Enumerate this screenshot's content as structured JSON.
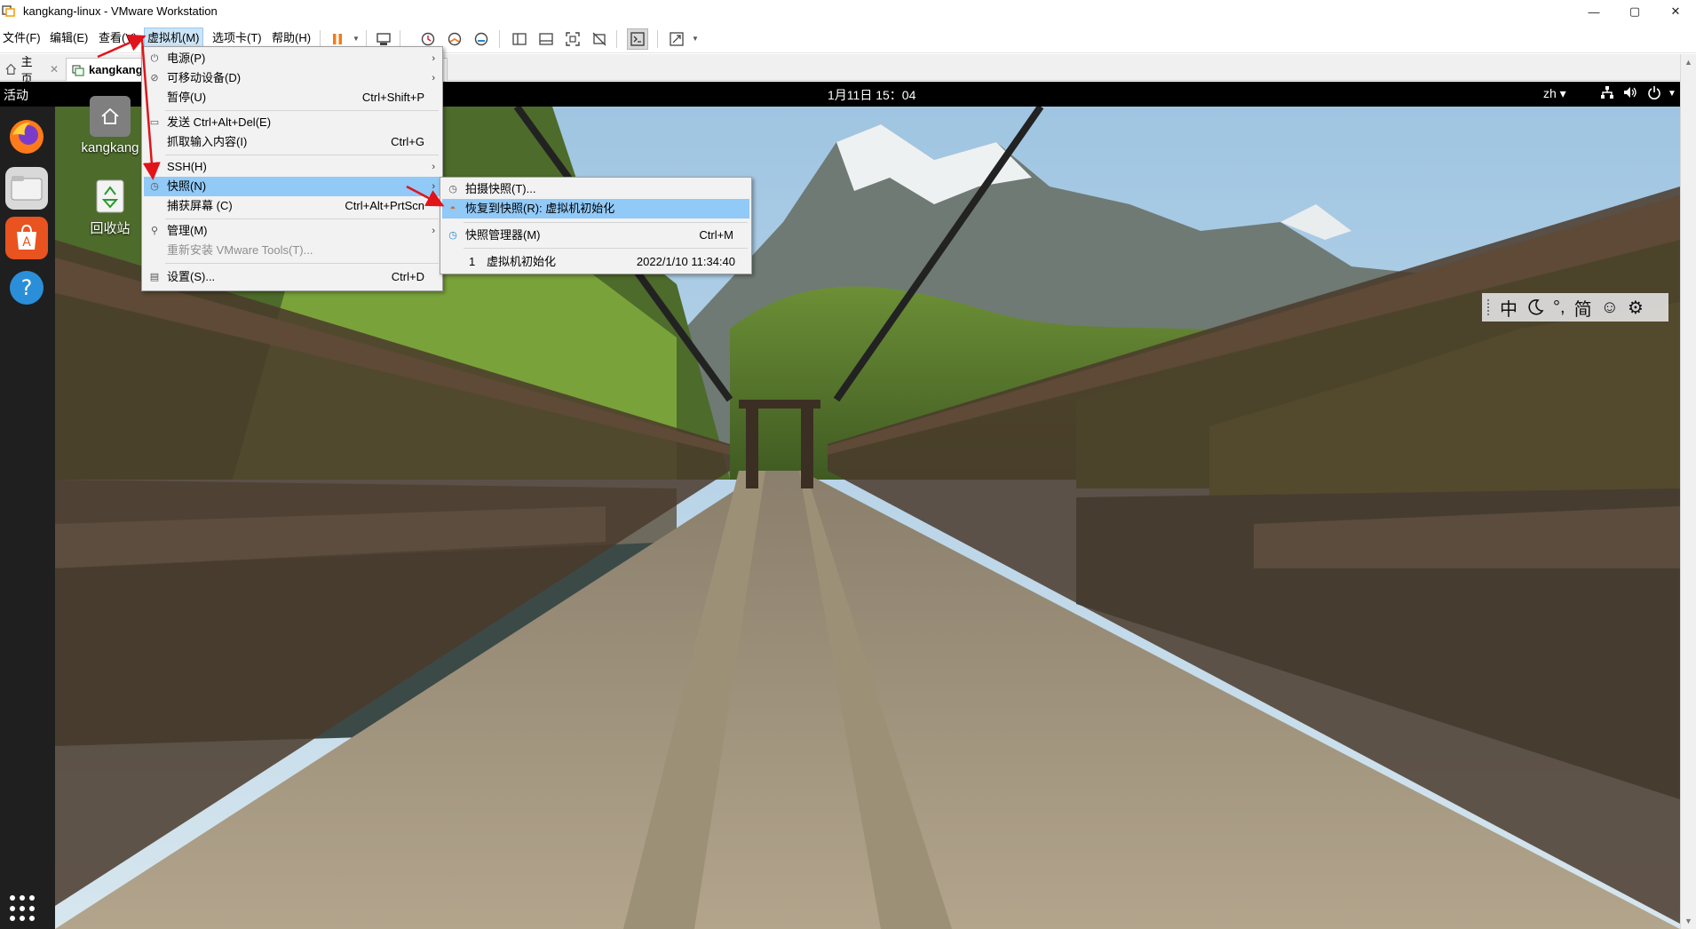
{
  "window": {
    "title": "kangkang-linux - VMware Workstation",
    "minimize": "—",
    "maximize": "▢",
    "close": "✕"
  },
  "menubar": {
    "file": "文件(F)",
    "edit": "编辑(E)",
    "view": "查看(V)",
    "vm": "虚拟机(M)",
    "tabs": "选项卡(T)",
    "help": "帮助(H)"
  },
  "toolbar": {
    "icons": [
      "pause-icon",
      "send-ctrl-alt-del-icon",
      "snapshot-take-icon",
      "snapshot-revert-icon",
      "snapshot-manager-icon",
      "show-library-icon",
      "thumbnail-bar-icon",
      "full-screen-icon",
      "unity-icon",
      "console-view-icon",
      "stretch-guest-icon"
    ]
  },
  "tabs": [
    {
      "label": "主页",
      "close": "✕"
    },
    {
      "label": "kangkang-",
      "close": ""
    }
  ],
  "guest": {
    "activities": "活动",
    "clock": "1月11日  15：04",
    "lang": "zh ▾",
    "desktop_icons": [
      {
        "label": "kangkang"
      },
      {
        "label": "回收站"
      }
    ],
    "ime": {
      "chinese": "中",
      "punct": "°,",
      "simplified": "简",
      "emoji": "☺",
      "settings": "⚙"
    }
  },
  "vm_menu": {
    "items": [
      {
        "label": "电源(P)",
        "shortcut": "",
        "submenu": true
      },
      {
        "label": "可移动设备(D)",
        "shortcut": "",
        "submenu": true
      },
      {
        "label": "暂停(U)",
        "shortcut": "Ctrl+Shift+P",
        "submenu": false
      },
      {
        "label": "发送 Ctrl+Alt+Del(E)",
        "shortcut": "",
        "submenu": false
      },
      {
        "label": "抓取输入内容(I)",
        "shortcut": "Ctrl+G",
        "submenu": false
      },
      {
        "label": "SSH(H)",
        "shortcut": "",
        "submenu": true
      },
      {
        "label": "快照(N)",
        "shortcut": "",
        "submenu": true
      },
      {
        "label": "捕获屏幕 (C)",
        "shortcut": "Ctrl+Alt+PrtScn",
        "submenu": false
      },
      {
        "label": "管理(M)",
        "shortcut": "",
        "submenu": true
      },
      {
        "label": "重新安装 VMware Tools(T)...",
        "shortcut": "",
        "submenu": false
      },
      {
        "label": "设置(S)...",
        "shortcut": "Ctrl+D",
        "submenu": false
      }
    ],
    "submenu_arrow": "›"
  },
  "snapshot_menu": {
    "take": "拍摄快照(T)...",
    "revert": "恢复到快照(R): 虚拟机初始化",
    "manager": "快照管理器(M)",
    "manager_shortcut": "Ctrl+M",
    "recent": {
      "index": "1",
      "name": "虚拟机初始化",
      "time": "2022/1/10 11:34:40"
    }
  },
  "colors": {
    "menu_highlight": "#91c9f7",
    "annotation_arrow": "#e0141a",
    "gnome_bar": "#000000",
    "dock": "#1f1f1f"
  }
}
